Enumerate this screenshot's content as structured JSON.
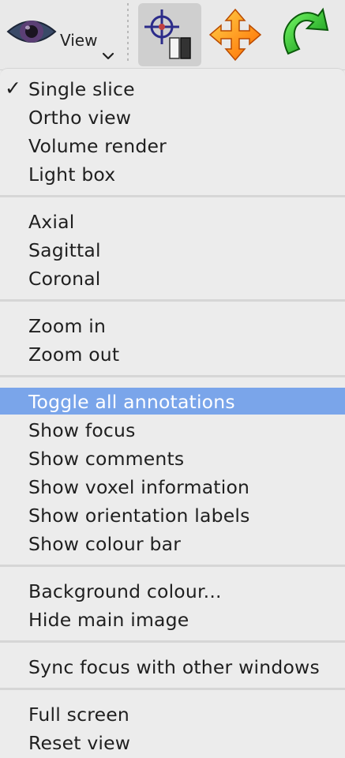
{
  "toolbar": {
    "view_label": "View",
    "tools": [
      {
        "icon": "crosshair-intensity-icon",
        "active": true
      },
      {
        "icon": "move-arrows-icon",
        "active": false
      },
      {
        "icon": "rotate-arrow-icon",
        "active": false
      }
    ]
  },
  "menu": {
    "groups": [
      {
        "items": [
          {
            "label": "Single slice",
            "checked": true
          },
          {
            "label": "Ortho view"
          },
          {
            "label": "Volume render"
          },
          {
            "label": "Light box"
          }
        ]
      },
      {
        "items": [
          {
            "label": "Axial"
          },
          {
            "label": "Sagittal"
          },
          {
            "label": "Coronal"
          }
        ]
      },
      {
        "items": [
          {
            "label": "Zoom in"
          },
          {
            "label": "Zoom out"
          }
        ]
      },
      {
        "items": [
          {
            "label": "Toggle all annotations",
            "highlighted": true
          },
          {
            "label": "Show focus"
          },
          {
            "label": "Show comments"
          },
          {
            "label": "Show voxel information"
          },
          {
            "label": "Show orientation labels"
          },
          {
            "label": "Show colour bar"
          }
        ]
      },
      {
        "items": [
          {
            "label": "Background colour..."
          },
          {
            "label": "Hide main image"
          }
        ]
      },
      {
        "items": [
          {
            "label": "Sync focus with other windows"
          }
        ]
      },
      {
        "items": [
          {
            "label": "Full screen"
          },
          {
            "label": "Reset view"
          }
        ]
      }
    ]
  },
  "colors": {
    "highlight": "#7aa5ea",
    "menu_bg": "#ececec"
  }
}
